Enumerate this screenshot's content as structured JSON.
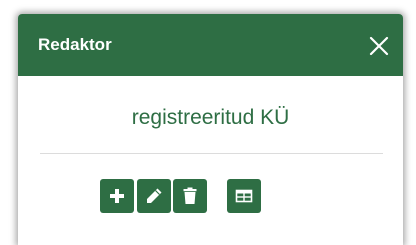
{
  "dialog": {
    "title": "Redaktor",
    "subtitle": "registreeritud KÜ",
    "close_icon": "close-icon"
  },
  "toolbar": {
    "buttons": [
      {
        "icon": "plus-icon"
      },
      {
        "icon": "pencil-icon"
      },
      {
        "icon": "trash-icon"
      },
      {
        "icon": "table-icon"
      }
    ]
  },
  "colors": {
    "header_bg": "#2e6e44",
    "accent": "#2e6e44",
    "header_text": "#ffffff",
    "divider": "#dcdcdc"
  }
}
